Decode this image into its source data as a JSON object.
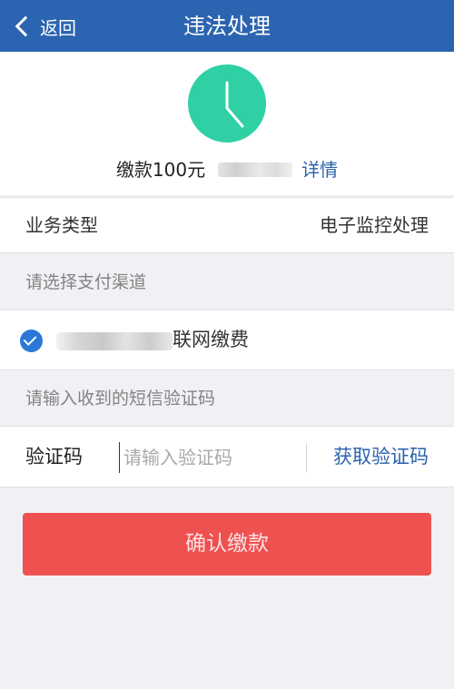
{
  "nav": {
    "back_label": "返回",
    "title": "违法处理"
  },
  "summary": {
    "icon": "clock-icon",
    "icon_color": "#2fd0a5",
    "fine_text": "缴款100元",
    "detail_link": "详情"
  },
  "business_type": {
    "label": "业务类型",
    "value": "电子监控处理"
  },
  "payment": {
    "section_label": "请选择支付渠道",
    "channel_label": "联网缴费",
    "selected": true
  },
  "sms": {
    "section_label": "请输入收到的短信验证码",
    "code_label": "验证码",
    "placeholder": "请输入验证码",
    "value": "",
    "get_code_label": "获取验证码"
  },
  "confirm_button": {
    "label": "确认缴款"
  },
  "colors": {
    "nav_bg": "#2b64b0",
    "accent": "#2a62ae",
    "confirm_bg": "#ef5150",
    "page_bg": "#f1f1f5"
  }
}
